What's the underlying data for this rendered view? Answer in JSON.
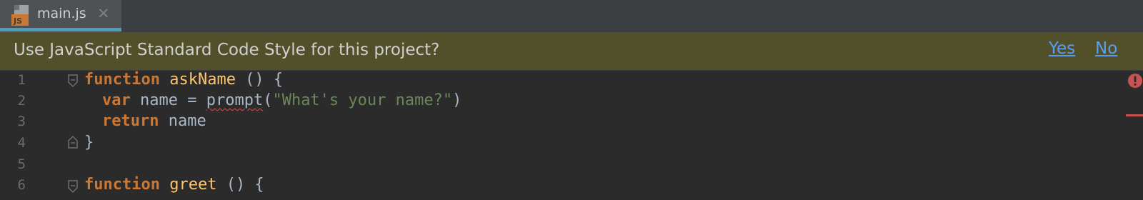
{
  "tab": {
    "file_name": "main.js",
    "icon_text": "JS",
    "close_glyph": "✕"
  },
  "banner": {
    "message": "Use JavaScript Standard Code Style for this project?",
    "yes_label": "Yes",
    "no_label": "No"
  },
  "editor": {
    "line_numbers": [
      "1",
      "2",
      "3",
      "4",
      "5",
      "6"
    ],
    "lines": [
      {
        "keyword": "function",
        "name": "askName",
        "rest": " () {"
      },
      {
        "keyword": "var",
        "text_a": " name = ",
        "call": "prompt",
        "paren_open": "(",
        "string": "\"What's your name?\"",
        "paren_close": ")"
      },
      {
        "keyword": "return",
        "text": " name"
      },
      {
        "text": "}"
      },
      {
        "text": ""
      },
      {
        "keyword": "function",
        "name": "greet",
        "rest": " () {"
      }
    ]
  },
  "colors": {
    "keyword": "#cc7832",
    "function_name": "#ffc66d",
    "string": "#6a8759",
    "banner_background": "#52502a",
    "link": "#589df6",
    "error": "#c75450"
  },
  "icons": [
    "js-file-icon",
    "close-icon",
    "fold-start-icon",
    "fold-end-icon",
    "error-icon"
  ]
}
